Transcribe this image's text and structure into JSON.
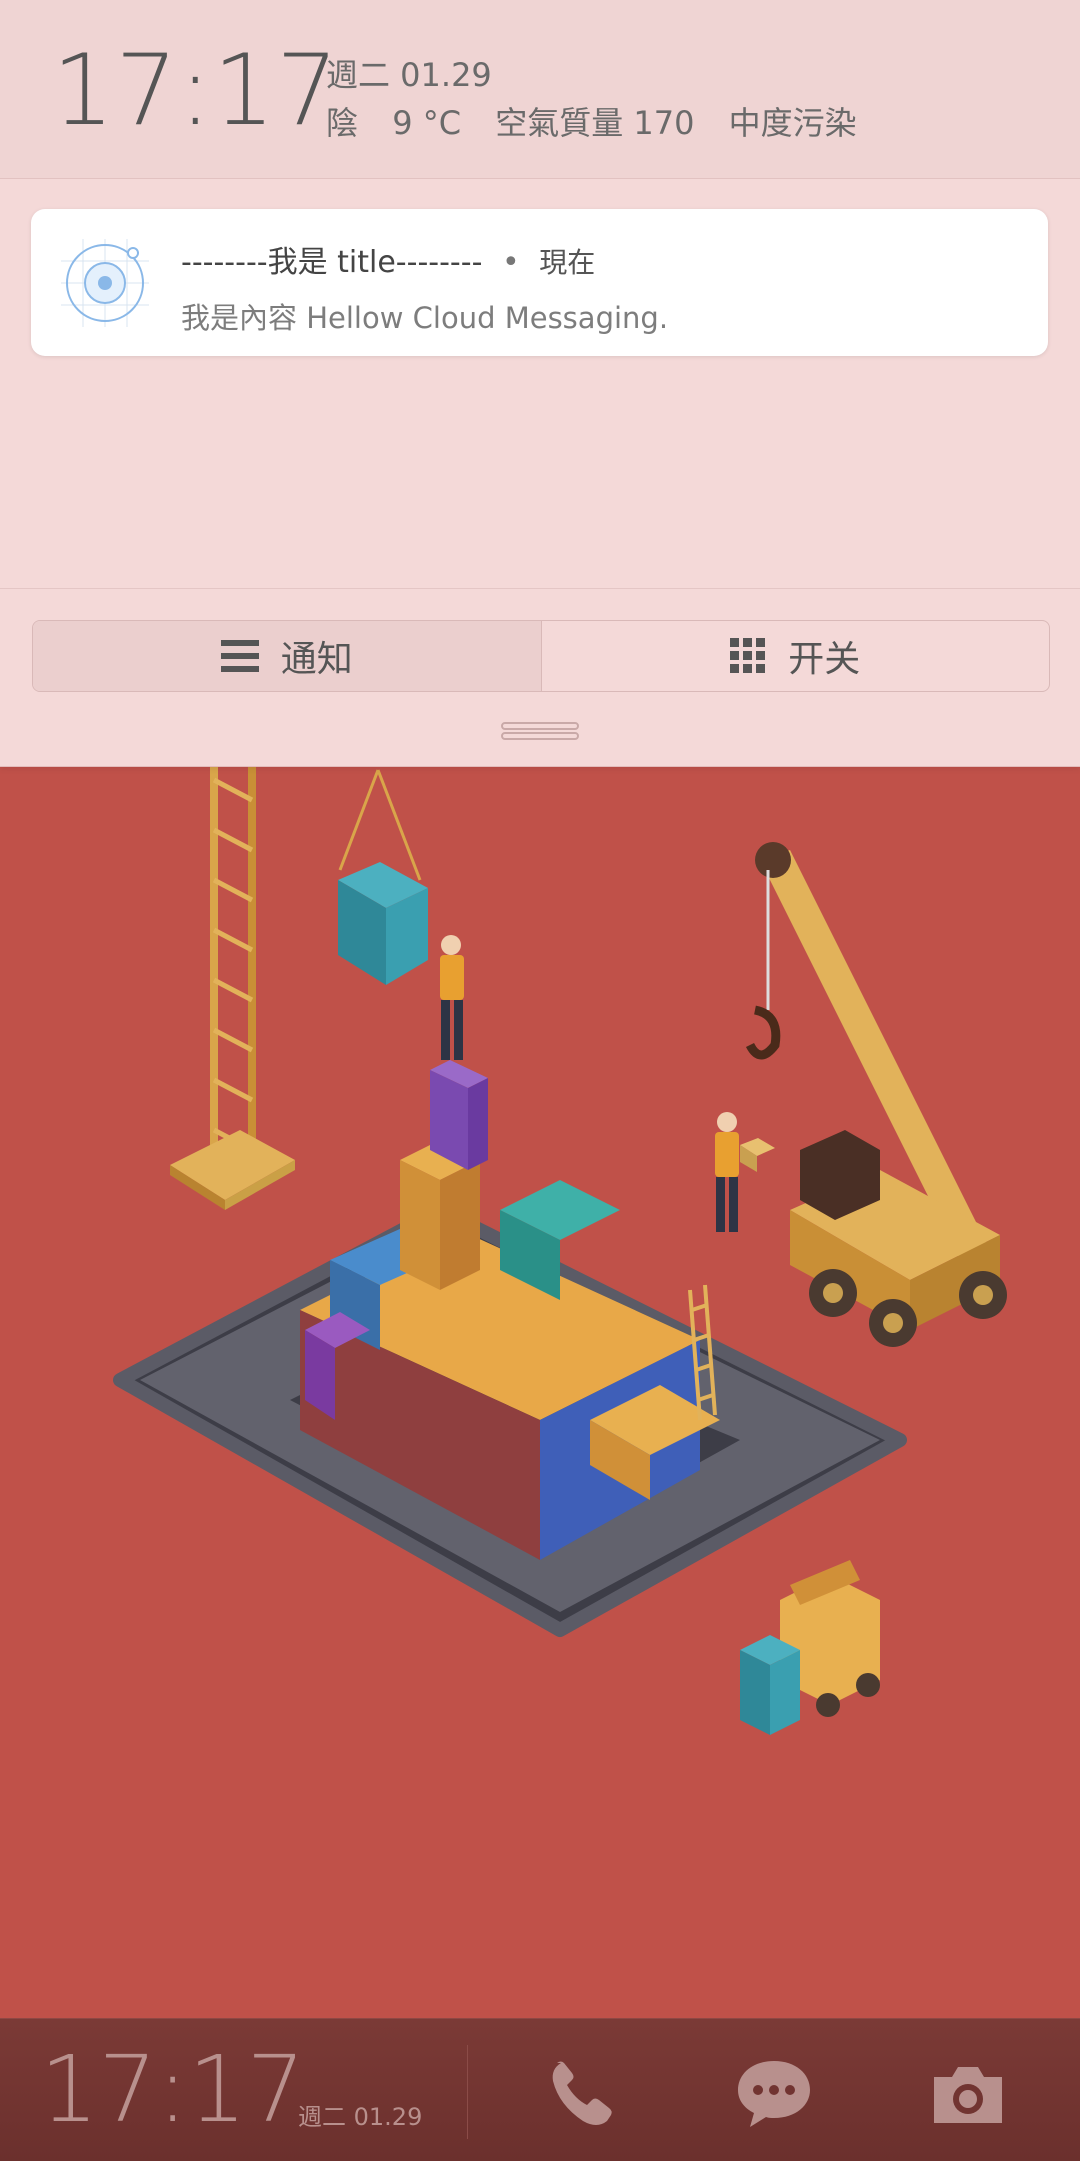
{
  "shade": {
    "time": "17:17",
    "date": "週二  01.29",
    "weather": {
      "condition": "陰",
      "temperature": "9 °C",
      "air_quality": "空氣質量 170",
      "pollution_level": "中度污染"
    }
  },
  "notification": {
    "app_icon": "app-logo-icon",
    "title": "--------我是 title--------",
    "separator": "•",
    "time": "現在",
    "body": "我是內容 Hellow Cloud Messaging."
  },
  "tabs": [
    {
      "label": "通知",
      "icon": "list-icon",
      "active": true
    },
    {
      "label": "开关",
      "icon": "grid-icon",
      "active": false
    }
  ],
  "dock": {
    "time": "17:17",
    "date": "週二   01.29",
    "buttons": [
      "phone-icon",
      "message-icon",
      "camera-icon"
    ]
  },
  "colors": {
    "wallpaper": "#c05149",
    "shade": "#f4d9d8",
    "dock": "#6b302d"
  }
}
